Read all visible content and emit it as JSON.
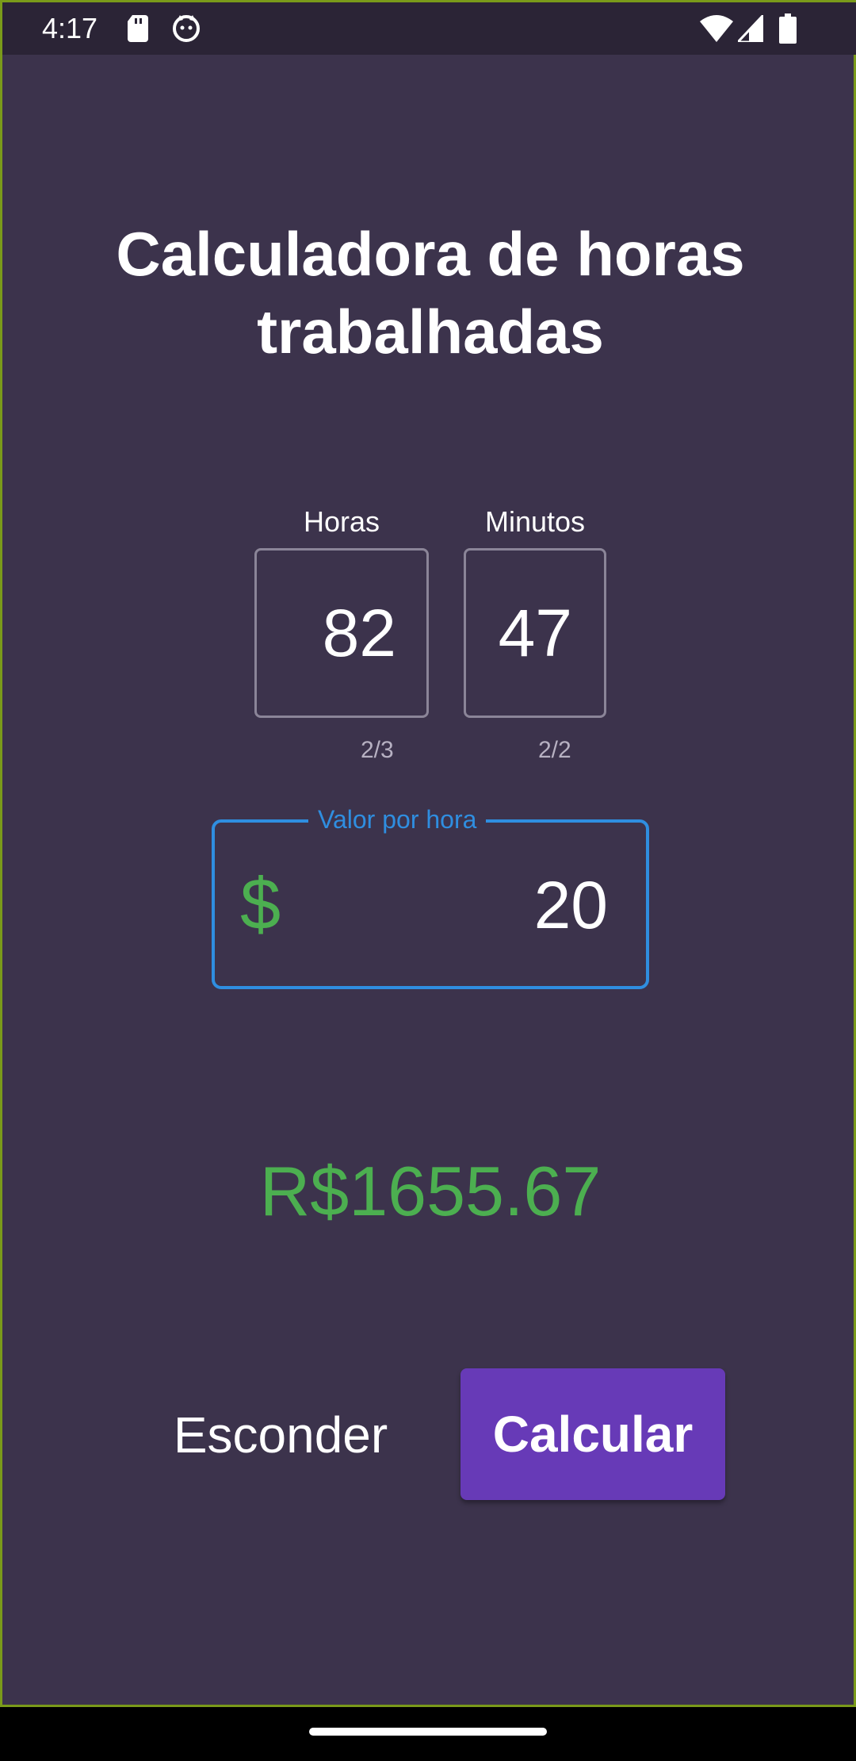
{
  "status_bar": {
    "time": "4:17",
    "icons": [
      "sd-card-icon",
      "cat-notification-icon",
      "wifi-icon",
      "signal-icon",
      "battery-icon"
    ]
  },
  "title": {
    "line1": "Calculadora de horas",
    "line2": "trabalhadas"
  },
  "hours_field": {
    "label": "Horas",
    "value": "82",
    "counter": "2/3"
  },
  "minutes_field": {
    "label": "Minutos",
    "value": "47",
    "counter": "2/2"
  },
  "rate_field": {
    "label": "Valor por hora",
    "prefix": "$",
    "value": "20"
  },
  "result": "R$1655.67",
  "buttons": {
    "hide": "Esconder",
    "calculate": "Calcular"
  },
  "colors": {
    "background": "#3c334c",
    "accent_blue": "#2f8ee0",
    "money_green": "#4caf50",
    "button_purple": "#673ab7"
  }
}
